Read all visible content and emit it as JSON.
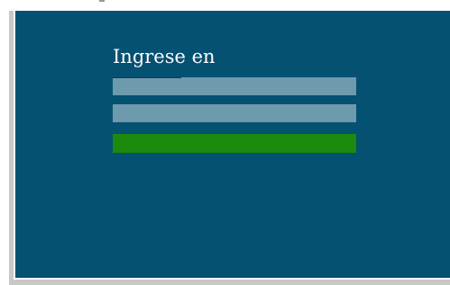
{
  "login": {
    "title": "Ingrese en",
    "username": {
      "value": "",
      "placeholder": ""
    },
    "password": {
      "value": "",
      "placeholder": ""
    },
    "submit_label": ""
  },
  "colors": {
    "panel_background": "#055172",
    "field_background": "#6d9aac",
    "submit_background": "#1b8a0d",
    "title_text": "#ffffff"
  }
}
